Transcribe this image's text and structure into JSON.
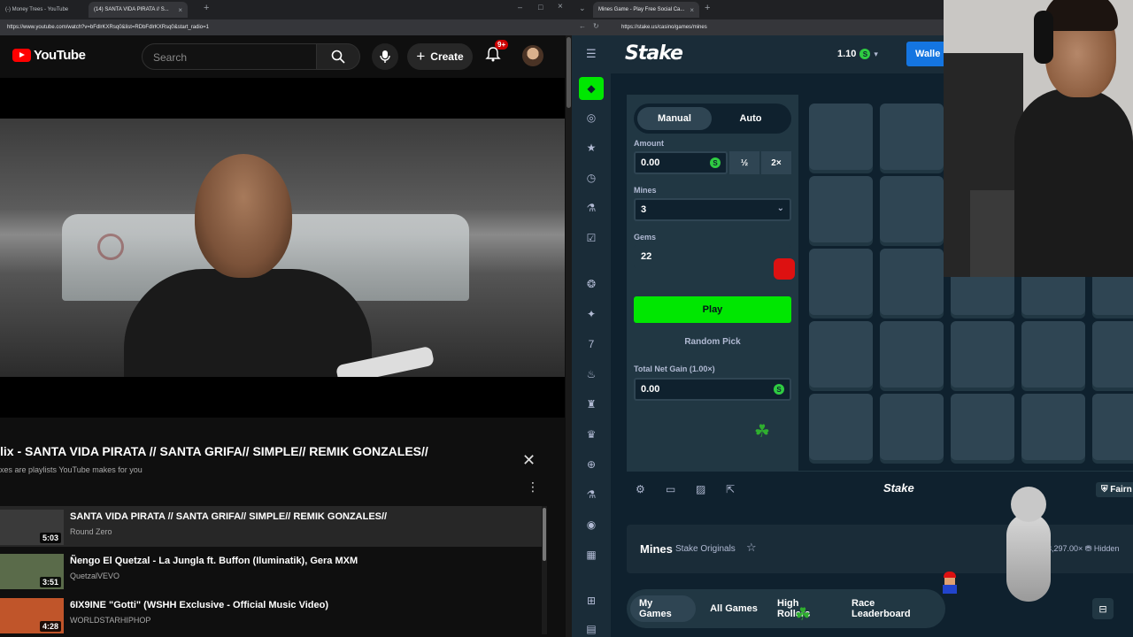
{
  "youtube_window": {
    "tabs": [
      {
        "label": "(-) Money Trees - YouTube"
      },
      {
        "label": "(14) SANTA VIDA PIRATA // S..."
      }
    ],
    "url": "https://www.youtube.com/watch?v=bFdlrKXRsq0&list=RDbFdlrKXRsq0&start_radio=1",
    "header": {
      "logo_text": "YouTube",
      "search_placeholder": "Search",
      "create_label": "Create",
      "notifications_badge": "9+"
    },
    "playlist": {
      "title": "lix - SANTA VIDA PIRATA // SANTA GRIFA// SIMPLE// REMIK GONZALES//",
      "subtitle": "xes are playlists YouTube makes for you",
      "items": [
        {
          "title": "SANTA VIDA PIRATA // SANTA GRIFA// SIMPLE// REMIK GONZALES//",
          "channel": "Round Zero",
          "duration": "5:03",
          "thumb_color": "#3a3a3a"
        },
        {
          "title": "Ñengo El Quetzal - La Jungla ft. Buffon (Iluminatik), Gera MXM",
          "channel": "QuetzalVEVO",
          "duration": "3:51",
          "thumb_color": "#5a6b4a"
        },
        {
          "title": "6IX9INE \"Gotti\" (WSHH Exclusive - Official Music Video)",
          "channel": "WORLDSTARHIPHOP",
          "duration": "4:28",
          "thumb_color": "#c0552a"
        }
      ]
    }
  },
  "stake_window": {
    "tabs": [
      {
        "label": "Mines Game - Play Free Social Ca..."
      }
    ],
    "url": "https://stake.us/casino/games/mines",
    "header": {
      "logo_text": "Stake",
      "balance": "1.10",
      "coin_symbol": "S",
      "wallet_label": "Walle"
    },
    "controls": {
      "mode_manual": "Manual",
      "mode_auto": "Auto",
      "amount_label": "Amount",
      "amount_value": "0.00",
      "half_label": "½",
      "double_label": "2×",
      "mines_label": "Mines",
      "mines_value": "3",
      "gems_label": "Gems",
      "gems_value": "22",
      "play_label": "Play",
      "random_label": "Random Pick",
      "net_gain_label": "Total Net Gain (1.00×)",
      "net_gain_value": "0.00"
    },
    "footer": {
      "logo_text": "Stake",
      "fairness_label": "Fairn"
    },
    "info": {
      "title": "Mines",
      "subtitle": "Stake Originals",
      "hidden_text": "3,297.00× ⛃ Hidden"
    },
    "bottom_tabs": [
      "My Games",
      "All Games",
      "High Rollers",
      "Race Leaderboard"
    ]
  },
  "colors": {
    "youtube_red": "#ff0000",
    "stake_green": "#00e701",
    "stake_bg": "#0f212e",
    "stake_panel": "#213743",
    "stake_tile": "#2f4553",
    "stake_blue": "#1475e1"
  }
}
